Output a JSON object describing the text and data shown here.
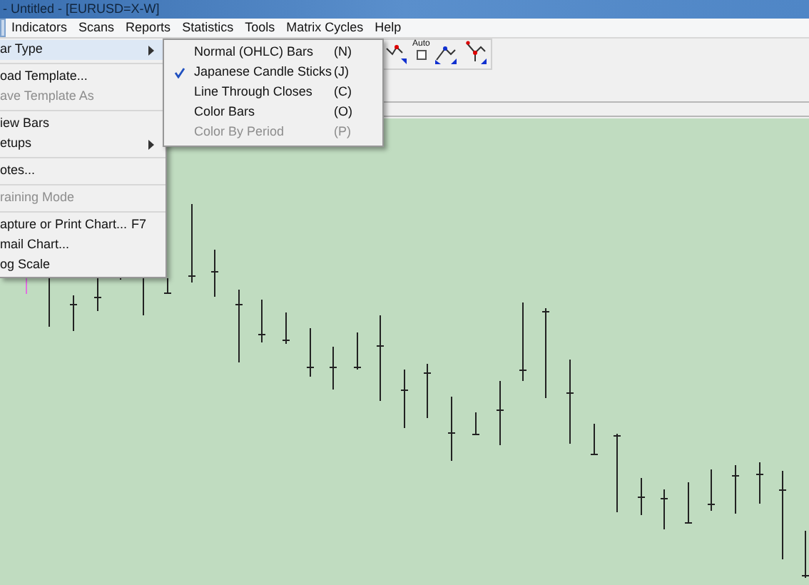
{
  "window": {
    "title": "- Untitled - [EURUSD=X-W]"
  },
  "menu_bar": [
    {
      "label": "Indicators",
      "selected": false
    },
    {
      "label": "Scans",
      "selected": false
    },
    {
      "label": "Reports",
      "selected": false
    },
    {
      "label": "Statistics",
      "selected": false
    },
    {
      "label": "Tools",
      "selected": false
    },
    {
      "label": "Matrix Cycles",
      "selected": false
    },
    {
      "label": "Help",
      "selected": false
    }
  ],
  "dropdown": {
    "items": [
      {
        "kind": "item",
        "label": "ar Type",
        "submenu": true,
        "selected": true,
        "disabled": false
      },
      {
        "kind": "separator"
      },
      {
        "kind": "item",
        "label": "oad Template...",
        "submenu": false,
        "selected": false,
        "disabled": false
      },
      {
        "kind": "item",
        "label": "ave Template As",
        "submenu": false,
        "selected": false,
        "disabled": true
      },
      {
        "kind": "separator"
      },
      {
        "kind": "item",
        "label": "iew Bars",
        "submenu": false,
        "selected": false,
        "disabled": false
      },
      {
        "kind": "item",
        "label": "etups",
        "submenu": true,
        "selected": false,
        "disabled": false
      },
      {
        "kind": "separator"
      },
      {
        "kind": "item",
        "label": "otes...",
        "submenu": false,
        "selected": false,
        "disabled": false
      },
      {
        "kind": "separator"
      },
      {
        "kind": "item",
        "label": "raining Mode",
        "submenu": false,
        "selected": false,
        "disabled": true
      },
      {
        "kind": "separator"
      },
      {
        "kind": "item",
        "label": "apture or Print Chart...",
        "shortcut": "F7",
        "submenu": false,
        "selected": false,
        "disabled": false
      },
      {
        "kind": "item",
        "label": "mail Chart...",
        "submenu": false,
        "selected": false,
        "disabled": false
      },
      {
        "kind": "item",
        "label": "og Scale",
        "submenu": false,
        "selected": false,
        "disabled": false
      }
    ]
  },
  "submenu": {
    "items": [
      {
        "label": "Normal (OHLC) Bars",
        "shortcut": "(N)",
        "checked": false,
        "disabled": false
      },
      {
        "label": "Japanese Candle Sticks",
        "shortcut": "(J)",
        "checked": true,
        "disabled": false
      },
      {
        "label": "Line Through Closes",
        "shortcut": "(C)",
        "checked": false,
        "disabled": false
      },
      {
        "label": "Color Bars",
        "shortcut": "(O)",
        "checked": false,
        "disabled": false
      },
      {
        "label": "Color By Period",
        "shortcut": "(P)",
        "checked": false,
        "disabled": true
      }
    ]
  },
  "toolbar": {
    "auto_label": "Auto",
    "auto_checked": false
  }
}
